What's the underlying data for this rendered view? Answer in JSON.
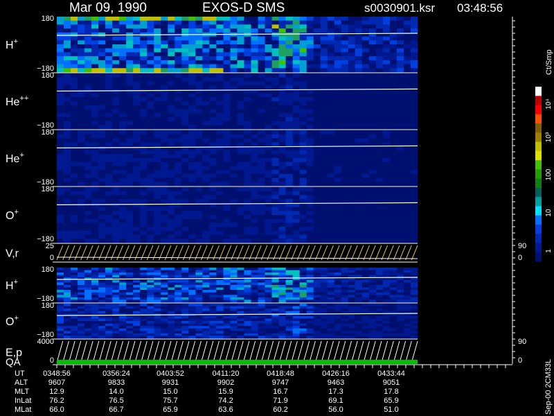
{
  "header": {
    "date": "Mar 09, 1990",
    "instrument": "EXOS-D SMS",
    "file": "s0030901.ksr",
    "time": "03:48:56"
  },
  "footer_note": "Sep-00 2CM33L",
  "colorbar": {
    "unit_label": "Ct/Smp",
    "labels": [
      "10⁴",
      "10³",
      "100",
      "10",
      "1"
    ],
    "colors": [
      "#ffffff",
      "#c00000",
      "#ff0000",
      "#ff5000",
      "#806000",
      "#a08000",
      "#c0c000",
      "#e0e000",
      "#40c000",
      "#20a000",
      "#108010",
      "#006060",
      "#00a0a0",
      "#00e0ff",
      "#0070ff",
      "#0040e0",
      "#0028b0",
      "#001890",
      "#001070"
    ]
  },
  "chart_data": {
    "type": "heatmap",
    "panels": [
      {
        "name": "H+",
        "label": "H",
        "sup": "+",
        "ymax": "180",
        "ymin": "−180",
        "intensity": 0.65,
        "right_top": "",
        "right_bottom": ""
      },
      {
        "name": "He++",
        "label": "He",
        "sup": "++",
        "ymax": "180",
        "ymin": "−180",
        "intensity": 0.15,
        "right_top": "",
        "right_bottom": ""
      },
      {
        "name": "He+",
        "label": "He",
        "sup": "+",
        "ymax": "180",
        "ymin": "−180",
        "intensity": 0.2,
        "right_top": "",
        "right_bottom": ""
      },
      {
        "name": "O+",
        "label": "O",
        "sup": "+",
        "ymax": "180",
        "ymin": "−180",
        "intensity": 0.18,
        "right_top": "",
        "right_bottom": ""
      },
      {
        "name": "V,r",
        "label": "V,r",
        "sup": "",
        "ymax": "25",
        "ymin": "0",
        "intensity": 0,
        "right_top": "90",
        "right_bottom": "0"
      },
      {
        "name": "H+ (2)",
        "label": "H",
        "sup": "+",
        "ymax": "180",
        "ymin": "−180",
        "intensity": 0.55,
        "right_top": "",
        "right_bottom": ""
      },
      {
        "name": "O+ (2)",
        "label": "O",
        "sup": "+",
        "ymax": "180",
        "ymin": "−180",
        "intensity": 0.35,
        "right_top": "",
        "right_bottom": ""
      },
      {
        "name": "E,p QA",
        "label": "E,p",
        "label2": "QA",
        "sup": "",
        "ymax": "4000",
        "ymin": "0",
        "intensity": 0,
        "right_top": "90",
        "right_bottom": "0"
      }
    ],
    "ephemeris": {
      "rows": [
        {
          "name": "UT",
          "values": [
            "0348:56",
            "0356:24",
            "0403:52",
            "0411:20",
            "0418:48",
            "0426:16",
            "0433:44"
          ]
        },
        {
          "name": "ALT",
          "values": [
            "9607",
            "9833",
            "9931",
            "9902",
            "9747",
            "9463",
            "9051"
          ]
        },
        {
          "name": "MLT",
          "values": [
            "12.9",
            "14.0",
            "15.0",
            "15.9",
            "16.7",
            "17.3",
            "17.8"
          ]
        },
        {
          "name": "InLat",
          "values": [
            "76.2",
            "76.5",
            "75.7",
            "74.2",
            "71.9",
            "69.1",
            "65.9"
          ]
        },
        {
          "name": "MLat",
          "values": [
            "66.0",
            "66.7",
            "65.9",
            "63.6",
            "60.2",
            "56.0",
            "51.0"
          ]
        }
      ]
    }
  }
}
